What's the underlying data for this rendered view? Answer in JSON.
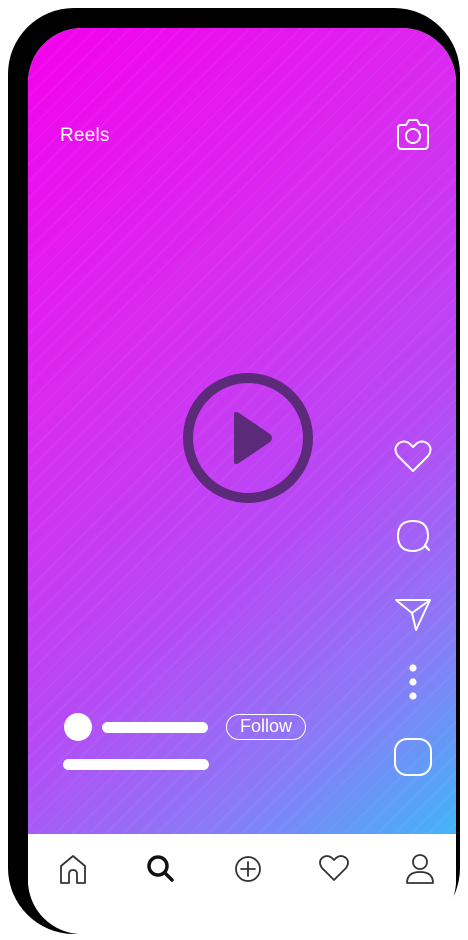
{
  "header": {
    "title": "Reels",
    "camera_icon": "camera-icon"
  },
  "player": {
    "play_icon": "play-icon"
  },
  "actions": [
    {
      "name": "like",
      "icon": "heart-icon"
    },
    {
      "name": "comment",
      "icon": "comment-icon"
    },
    {
      "name": "share",
      "icon": "send-icon"
    },
    {
      "name": "more",
      "icon": "more-icon"
    },
    {
      "name": "audio",
      "icon": "audio-thumbnail-icon"
    }
  ],
  "post": {
    "follow_label": "Follow"
  },
  "tabbar": {
    "items": [
      {
        "name": "home",
        "icon": "home-icon"
      },
      {
        "name": "search",
        "icon": "search-icon"
      },
      {
        "name": "create",
        "icon": "add-icon"
      },
      {
        "name": "activity",
        "icon": "heart-icon"
      },
      {
        "name": "profile",
        "icon": "profile-icon"
      }
    ]
  },
  "colors": {
    "gradient_start": "#f400ec",
    "gradient_mid": "#b64af5",
    "gradient_end": "#42b4f8",
    "play_button": "#5b2a78",
    "frame": "#000000"
  }
}
